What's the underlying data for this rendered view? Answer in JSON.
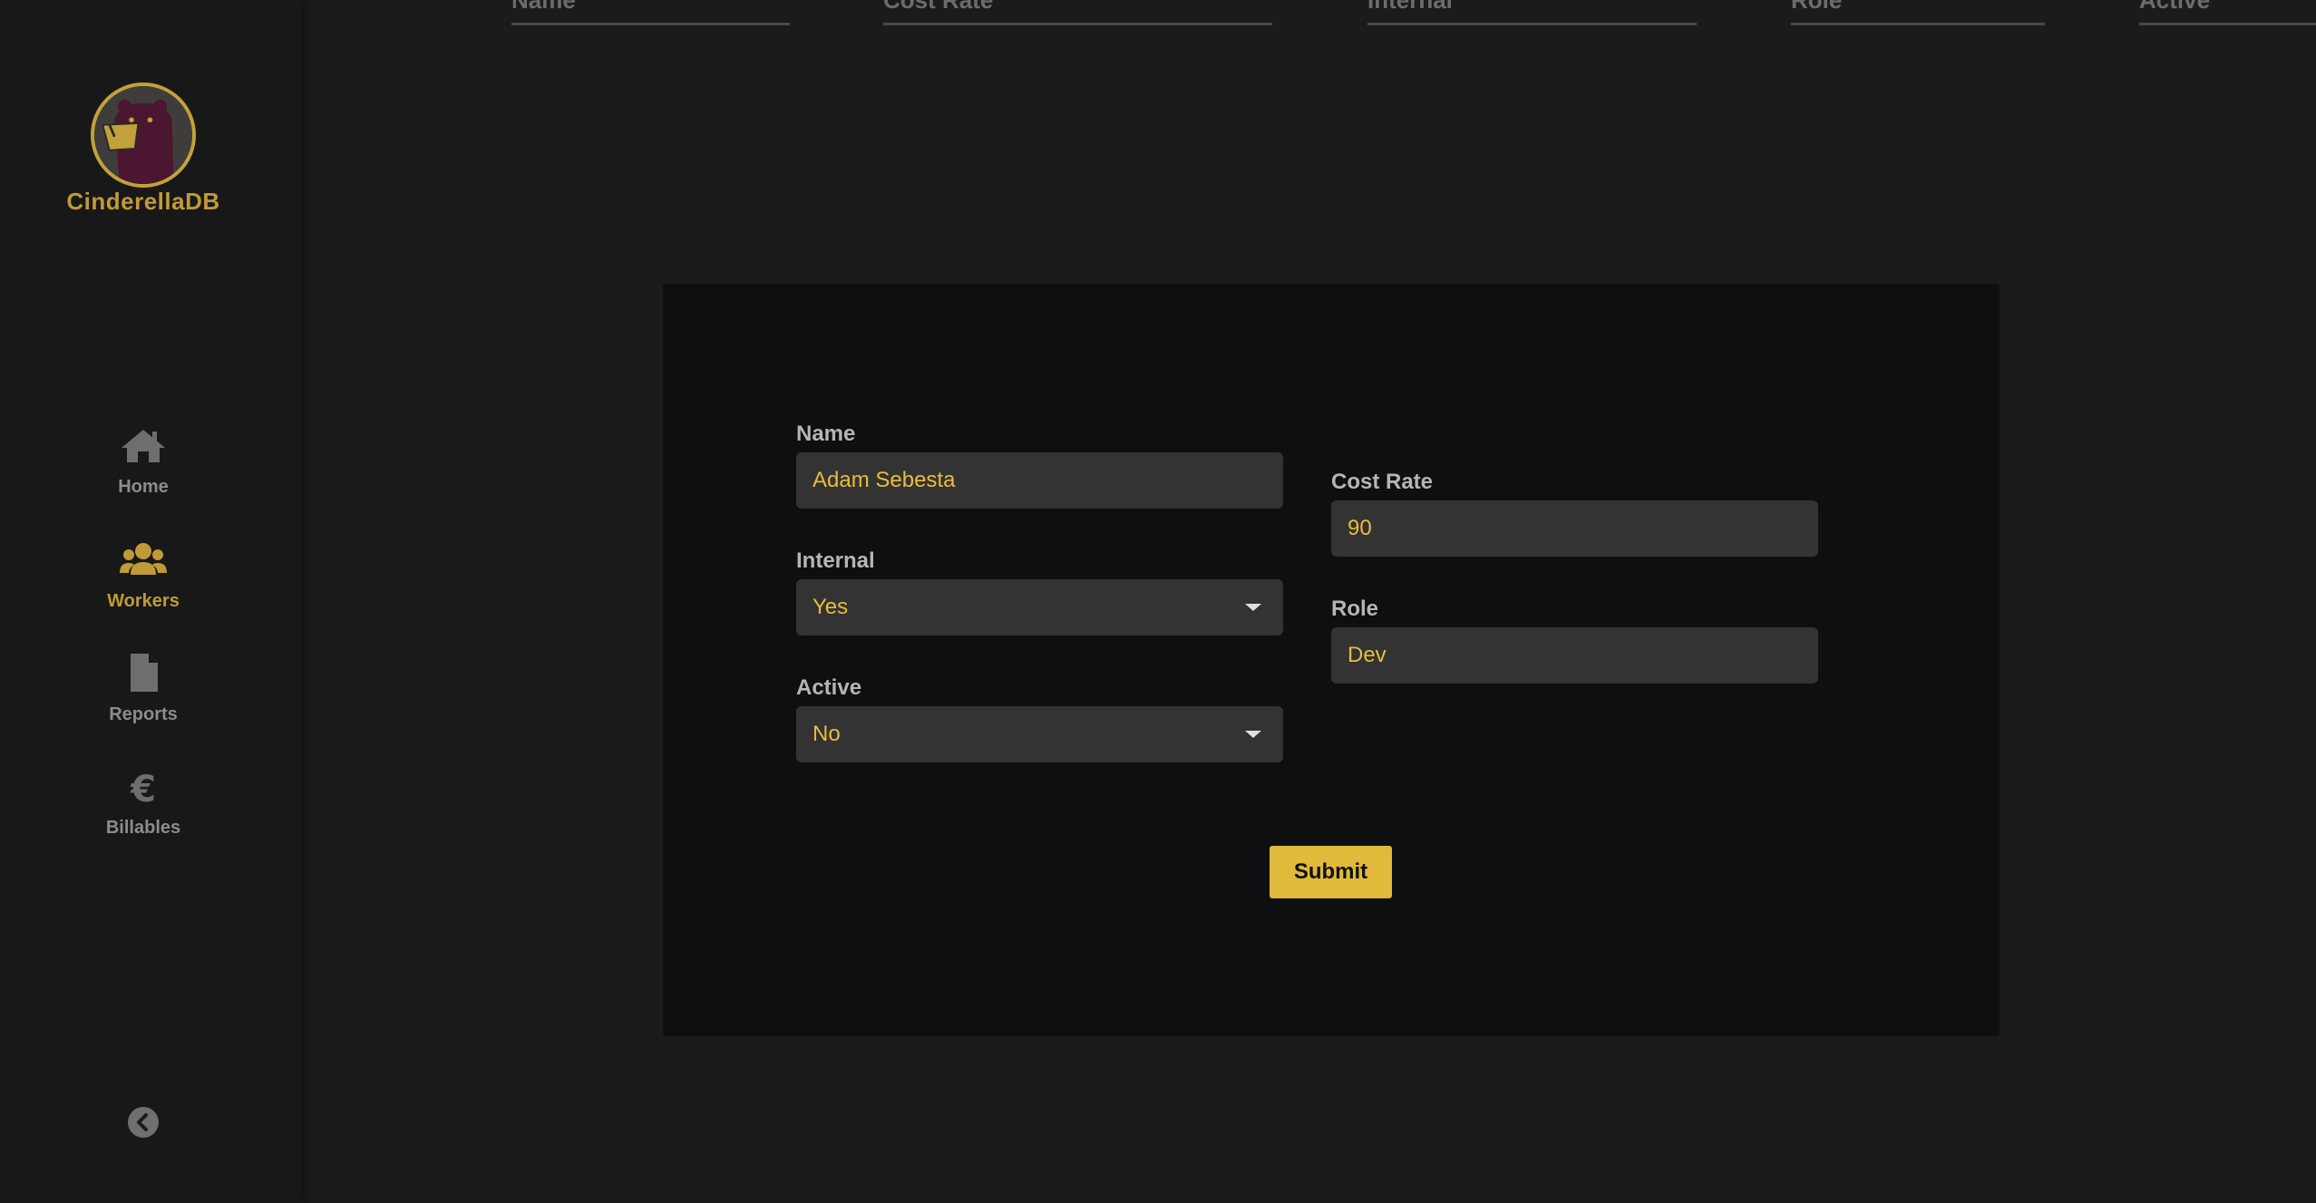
{
  "brand": {
    "name": "CinderellaDB"
  },
  "nav": [
    {
      "label": "Home",
      "icon": "home-icon",
      "active": false
    },
    {
      "label": "Workers",
      "icon": "users-icon",
      "active": true
    },
    {
      "label": "Reports",
      "icon": "file-icon",
      "active": false
    },
    {
      "label": "Billables",
      "icon": "euro-icon",
      "active": false
    }
  ],
  "table_headers": [
    "Name",
    "Cost Rate",
    "Internal",
    "Role",
    "Active"
  ],
  "form": {
    "name": {
      "label": "Name",
      "value": "Adam Sebesta"
    },
    "cost_rate": {
      "label": "Cost Rate",
      "value": "90"
    },
    "internal": {
      "label": "Internal",
      "value": "Yes"
    },
    "role": {
      "label": "Role",
      "value": "Dev"
    },
    "active": {
      "label": "Active",
      "value": "No"
    },
    "submit_label": "Submit"
  },
  "colors": {
    "accent": "#e1b93b",
    "brand_gold": "#c09a36",
    "sidebar_bg": "#181818",
    "page_bg": "#1b1b1b",
    "modal_bg": "#0e0f10",
    "input_bg": "#333333"
  }
}
